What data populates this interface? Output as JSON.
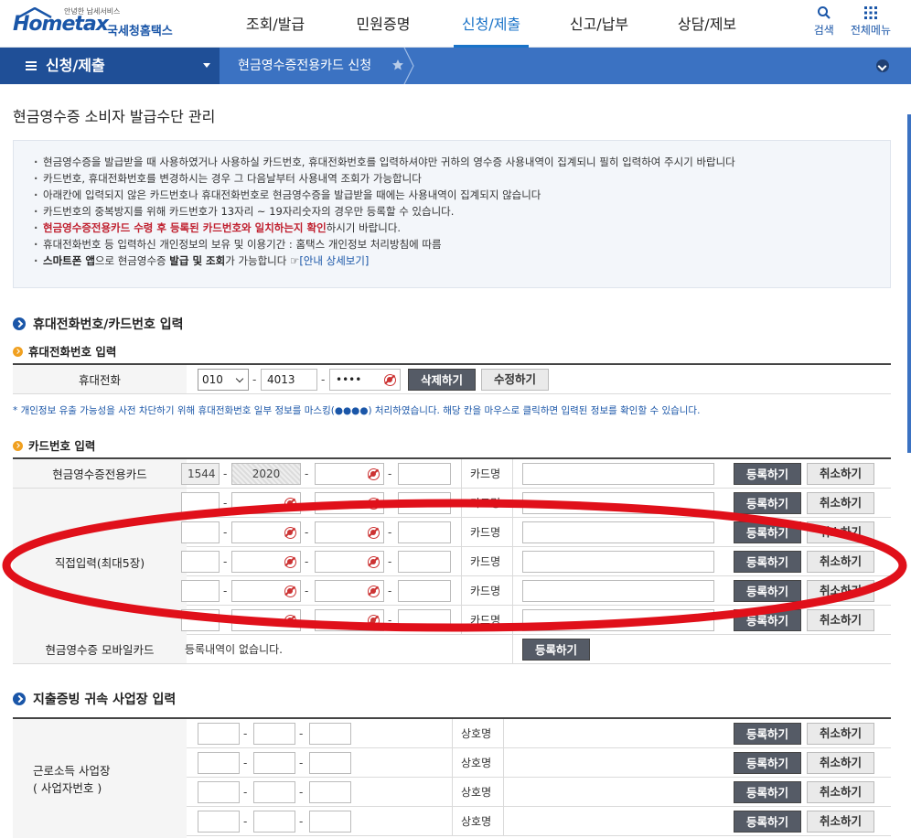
{
  "header": {
    "logo_small": "안녕한 납세서비스",
    "logo_brand": "Hometax",
    "logo_korean": "국세청홈택스",
    "nav": [
      "조회/발급",
      "민원증명",
      "신청/제출",
      "신고/납부",
      "상담/제보"
    ],
    "active_nav": "신청/제출",
    "search_label": "검색",
    "menu_label": "전체메뉴"
  },
  "breadcrumb": {
    "main": "신청/제출",
    "sub": "현금영수증전용카드 신청"
  },
  "page_title": "현금영수증 소비자 발급수단 관리",
  "notice": {
    "items": [
      "현금영수증을 발급받을 때 사용하였거나 사용하실 카드번호, 휴대전화번호를 입력하셔야만 귀하의 영수증 사용내역이 집계되니 필히 입력하여 주시기 바랍니다",
      "카드번호, 휴대전화번호를 변경하시는 경우 그 다음날부터 사용내역 조회가 가능합니다",
      "아래칸에 입력되지 않은 카드번호나 휴대전화번호로 현금영수증을 발급받을 때에는 사용내역이 집계되지 않습니다",
      "카드번호의 중복방지를 위해 카드번호가 13자리 ~ 19자리숫자의 경우만 등록할 수 있습니다."
    ],
    "red_item": "현금영수증전용카드 수령 후 등록된 카드번호와 일치하는지 확인",
    "red_item_tail": "하시기 바랍니다.",
    "privacy_item": "휴대전화번호 등 입력하신 개인정보의 보유 및 이용기간 : 홈택스 개인정보 처리방침에 따름",
    "app_item_bold1": "스마트폰 앱",
    "app_item_mid1": "으로 현금영수증 ",
    "app_item_bold2": "발급 및 조회",
    "app_item_mid2": "가 가능합니다 ☞",
    "app_item_link": "[안내 상세보기]"
  },
  "section1": {
    "title": "휴대전화번호/카드번호 입력",
    "phone_sub": "휴대전화번호 입력",
    "phone_label": "휴대전화",
    "phone_prefix": "010",
    "phone_mid": "4013",
    "phone_last": "••••",
    "delete_button": "삭제하기",
    "edit_button": "수정하기",
    "mask_note": "* 개인정보 유출 가능성을 사전 차단하기 위해 휴대전화번호 일부 정보를 마스킹(●●●●) 처리하였습니다. 해당 칸을 마우스로 클릭하면 입력된 정보를 확인할 수 있습니다.",
    "card_sub": "카드번호 입력",
    "dedicated_card_label": "현금영수증전용카드",
    "dedicated_card_part1": "1544",
    "dedicated_card_part2": "2020",
    "card_name_label": "카드명",
    "register_button": "등록하기",
    "cancel_button": "취소하기",
    "direct_input_label": "직접입력(최대5장)",
    "mobile_card_label": "현금영수증 모바일카드",
    "mobile_card_empty": "등록내역이 없습니다."
  },
  "section2": {
    "title": "지출증빙 귀속 사업장 입력",
    "label_line1": "근로소득 사업장",
    "label_line2": "( 사업자번호 )",
    "company_label": "상호명",
    "register_button": "등록하기",
    "cancel_button": "취소하기"
  },
  "colors": {
    "brand": "#1a56a8",
    "crumb_dark": "#1f4f97",
    "crumb": "#3b72c2",
    "highlight_red": "#c0202f",
    "annotation_red": "#e0101a"
  },
  "icons": [
    "search-icon",
    "grid-menu-icon",
    "hamburger-icon",
    "star-icon",
    "chevron-down-icon",
    "eye-hide-icon",
    "section-arrow-icon"
  ]
}
